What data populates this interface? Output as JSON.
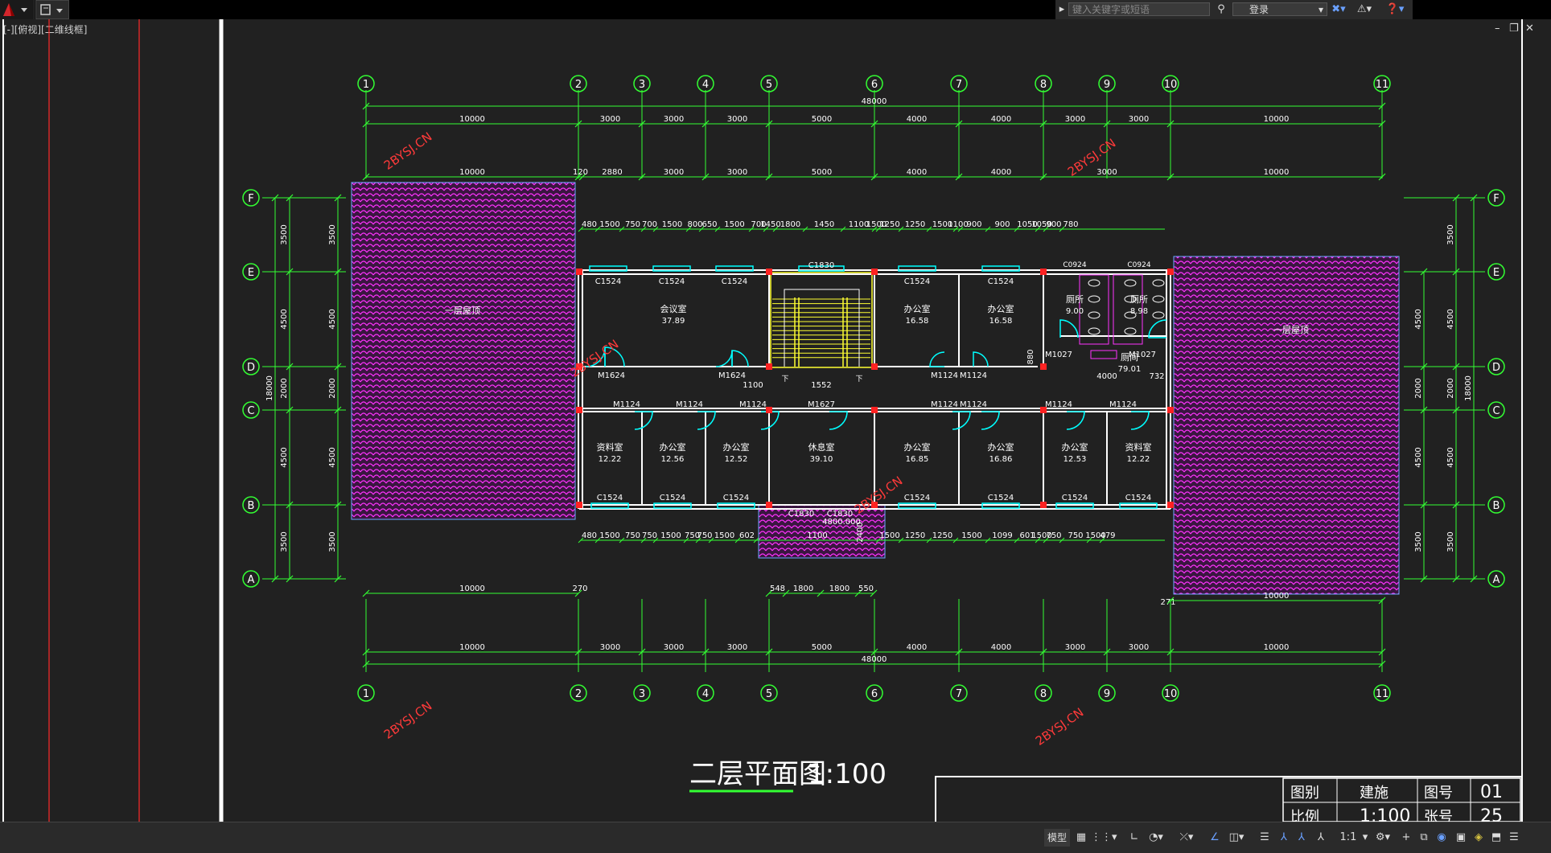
{
  "app": {
    "search_placeholder": "键入关键字或短语",
    "login_label": "登录",
    "viewport_label": "[-][俯视][二维线框]"
  },
  "drawing": {
    "title": "二层平面图",
    "scale": "1:100",
    "watermark": "2BYSJ.CN",
    "axis_numbers": [
      "1",
      "2",
      "3",
      "4",
      "5",
      "6",
      "7",
      "8",
      "9",
      "10",
      "11"
    ],
    "axis_letters": [
      "F",
      "E",
      "D",
      "C",
      "B",
      "A"
    ],
    "dim_total": "48000",
    "dims_top_row": [
      "10000",
      "3000",
      "3000",
      "3000",
      "5000",
      "4000",
      "4000",
      "3000",
      "3000",
      "10000"
    ],
    "dims_top_second": [
      "10000",
      "120",
      "2880",
      "3000",
      "3000",
      "5000",
      "4000",
      "4000",
      "3000",
      "10000"
    ],
    "dims_bottom_row": [
      "10000",
      "3000",
      "3000",
      "3000",
      "5000",
      "4000",
      "4000",
      "3000",
      "3000",
      "10000"
    ],
    "dims_bottom_second": [
      "10000",
      "270",
      "271",
      "10000"
    ],
    "dims_left_outer": [
      "3500",
      "4500",
      "2000",
      "4500",
      "3500"
    ],
    "dims_left_total": "18000",
    "dims_right_total": "18000",
    "upper_window_dims": [
      "480",
      "1500",
      "750",
      "700",
      "1500",
      "800",
      "650",
      "1500",
      "700",
      "1450",
      "1800",
      "1450",
      "1100",
      "1500",
      "1250",
      "1250",
      "1500",
      "1100",
      "900",
      "900",
      "1050",
      "1050",
      "900",
      "780"
    ],
    "lower_window_dims": [
      "480",
      "1500",
      "750",
      "750",
      "1500",
      "750",
      "750",
      "1500",
      "602",
      "1100",
      "1500",
      "1250",
      "1250",
      "1500",
      "1099",
      "601",
      "1500",
      "750",
      "750",
      "1500",
      "479"
    ],
    "porch_dims": [
      "548",
      "1800",
      "1800",
      "550"
    ],
    "porch_height": "2400",
    "stair_window": "C1830",
    "upper_windows": [
      "C1524",
      "C1524",
      "C1524",
      "C1524",
      "C1524"
    ],
    "lower_windows": [
      "C1524",
      "C1524",
      "C1524",
      "C1524",
      "C1524",
      "C1524",
      "C1524",
      "C1524"
    ],
    "porch_windows": [
      "C1830",
      "C1830"
    ],
    "toilet_windows": [
      "C0924",
      "C0924"
    ],
    "upper_doors": [
      "M1624",
      "M1624",
      "M1124",
      "M1124",
      "M1027",
      "M1027"
    ],
    "lower_doors": [
      "M1124",
      "M1124",
      "M1124",
      "M1627",
      "M1124",
      "M1124",
      "M1124",
      "M1124"
    ],
    "corridor_dims": [
      "1100",
      "1552",
      "880",
      "4000",
      "732"
    ],
    "roof_label": "一层屋顶",
    "rooms_upper": [
      {
        "name": "会议室",
        "area": "37.89"
      },
      {
        "name": "办公室",
        "area": "16.58"
      },
      {
        "name": "办公室",
        "area": "16.58"
      },
      {
        "name": "厕所",
        "area": "9.00"
      },
      {
        "name": "厕所",
        "area": "8.98"
      },
      {
        "name": "厕间",
        "area": "79.01"
      }
    ],
    "rooms_lower": [
      {
        "name": "资料室",
        "area": "12.22"
      },
      {
        "name": "办公室",
        "area": "12.56"
      },
      {
        "name": "办公室",
        "area": "12.52"
      },
      {
        "name": "休息室",
        "area": "39.10"
      },
      {
        "name": "办公室",
        "area": "16.85"
      },
      {
        "name": "办公室",
        "area": "16.86"
      },
      {
        "name": "办公室",
        "area": "12.53"
      },
      {
        "name": "资料室",
        "area": "12.22"
      }
    ],
    "porch_elevation": "4800.000",
    "stair_label_down": "下",
    "title_block": {
      "row1": [
        "图别",
        "建施",
        "图号",
        "01"
      ],
      "row2": [
        "比例",
        "1:100",
        "张号",
        "25"
      ]
    }
  },
  "statusbar": {
    "model_label": "模型",
    "scale_label": "1:1"
  },
  "colors": {
    "grid": "#33ff33",
    "wall": "#ffffff",
    "window": "#00ffff",
    "roof": "#ff33ff",
    "stair": "#ffff33",
    "watermark": "#ff3a3a",
    "column": "#ff2222"
  }
}
